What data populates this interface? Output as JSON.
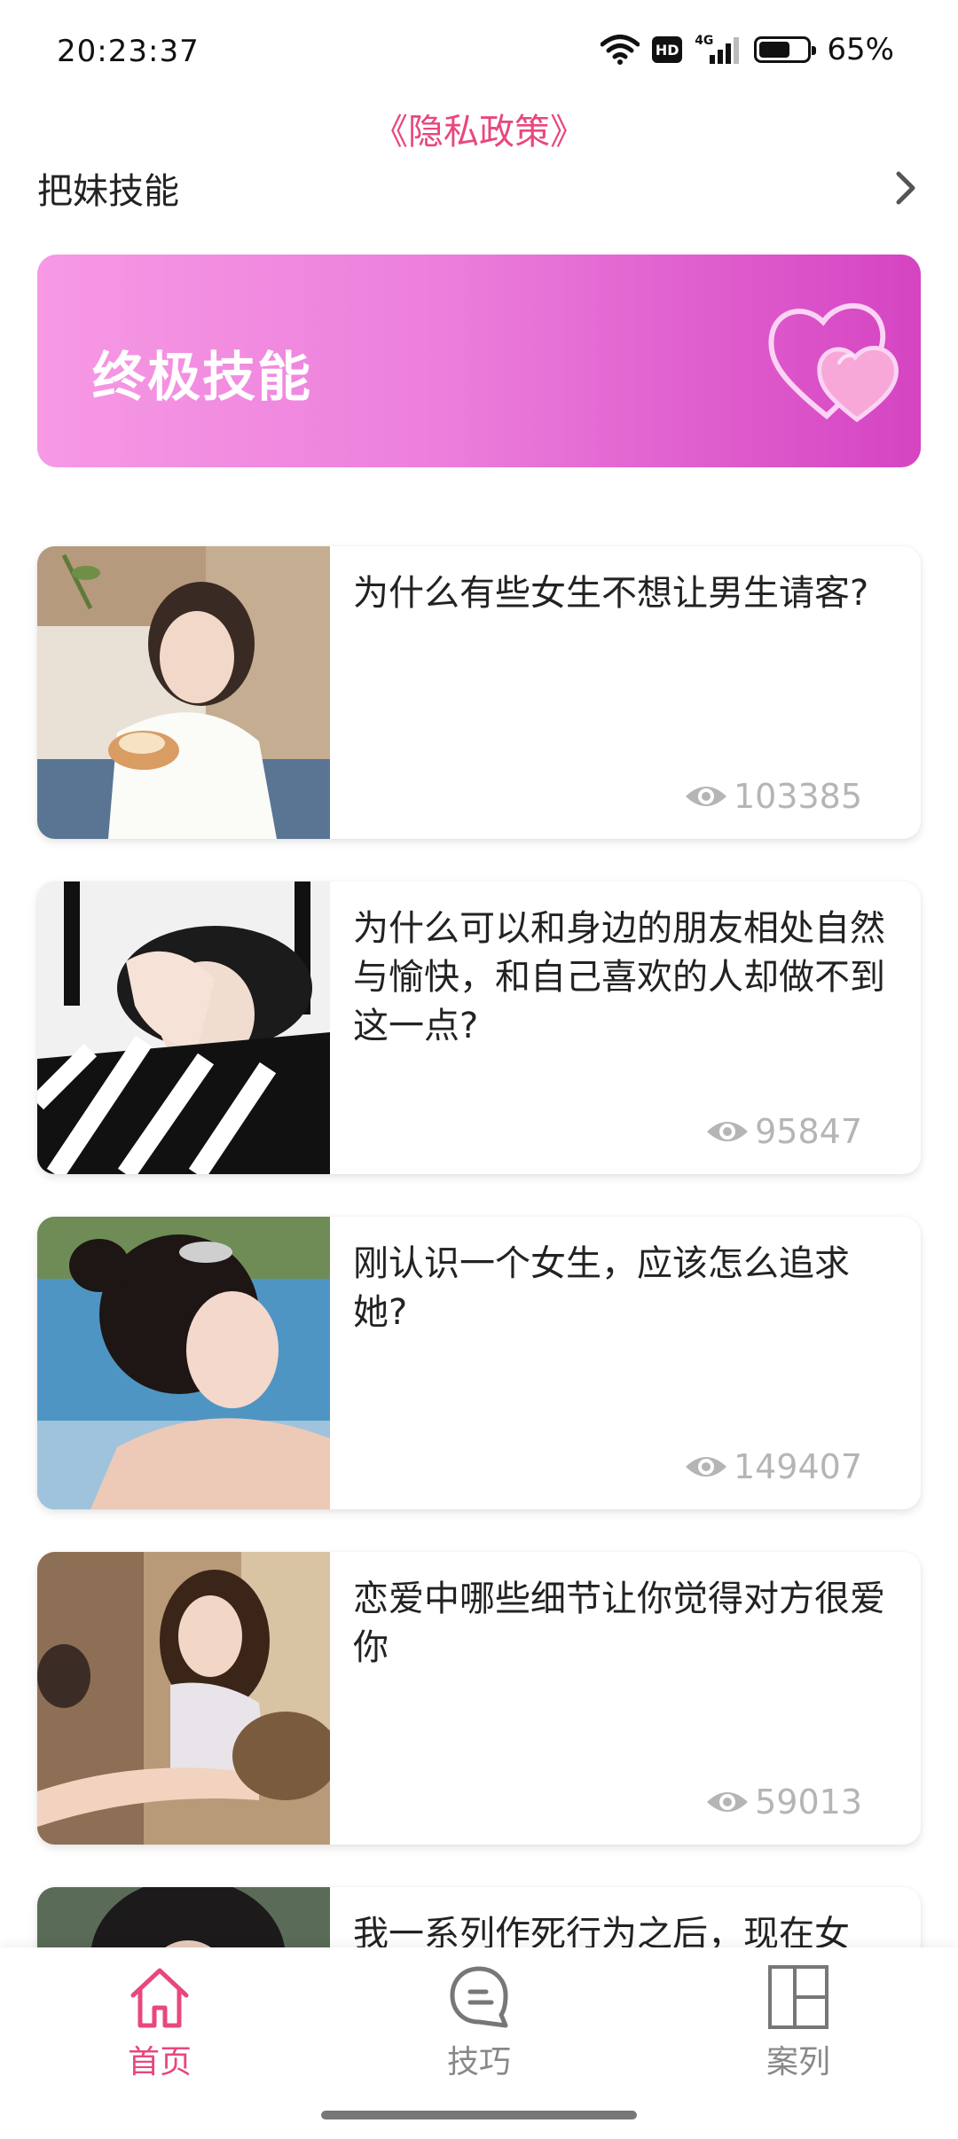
{
  "status_bar": {
    "time": "20:23:37",
    "hd": "HD",
    "network": "4G",
    "battery_percent": "65%",
    "battery_level": 0.65
  },
  "privacy_link": "《隐私政策》",
  "section": {
    "title": "把妹技能",
    "chevron_icon": "chevron-right-icon"
  },
  "banner": {
    "title": "终极技能",
    "icon": "hearts-icon"
  },
  "articles": [
    {
      "title": "为什么有些女生不想让男生请客?",
      "views": "103385"
    },
    {
      "title": "为什么可以和身边的朋友相处自然与愉快，和自己喜欢的人却做不到这一点?",
      "views": "95847"
    },
    {
      "title": "刚认识一个女生，应该怎么追求她?",
      "views": "149407"
    },
    {
      "title": "恋爱中哪些细节让你觉得对方很爱你",
      "views": "59013"
    },
    {
      "title": "我一系列作死行为之后，现在女",
      "views": ""
    }
  ],
  "bottom_nav": {
    "items": [
      {
        "label": "首页",
        "icon": "home-icon",
        "active": true
      },
      {
        "label": "技巧",
        "icon": "chat-bubble-icon",
        "active": false
      },
      {
        "label": "案列",
        "icon": "layout-grid-icon",
        "active": false
      }
    ]
  },
  "colors": {
    "accent": "#e8477f",
    "banner_start": "#f799e4",
    "banner_end": "#d544c2",
    "muted": "#b5b5b5"
  }
}
